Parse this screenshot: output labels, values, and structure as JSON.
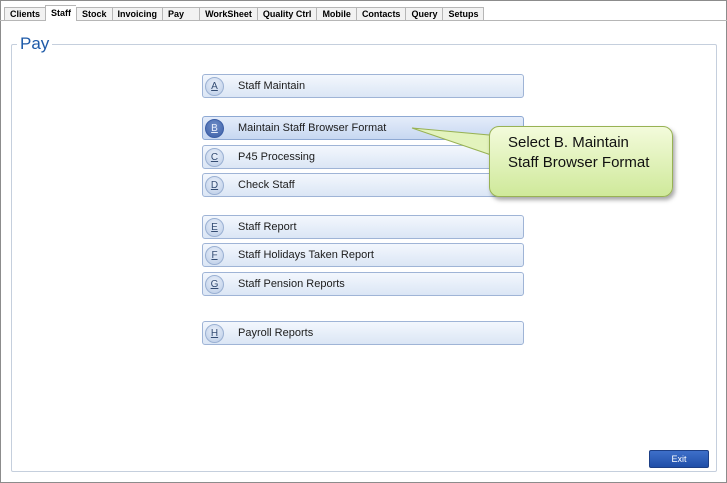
{
  "tabs": [
    {
      "label": "Clients"
    },
    {
      "label": "Staff",
      "active": true
    },
    {
      "label": "Stock"
    },
    {
      "label": "Invoicing"
    },
    {
      "label": "Pay"
    },
    {
      "label": "WorkSheet"
    },
    {
      "label": "Quality Ctrl"
    },
    {
      "label": "Mobile"
    },
    {
      "label": "Contacts"
    },
    {
      "label": "Query"
    },
    {
      "label": "Setups"
    }
  ],
  "page": {
    "title": "Pay"
  },
  "menu": [
    {
      "key": "A",
      "label": "Staff Maintain"
    },
    {
      "key": "B",
      "label": "Maintain Staff Browser Format",
      "highlighted": true
    },
    {
      "key": "C",
      "label": "P45 Processing"
    },
    {
      "key": "D",
      "label": "Check Staff"
    },
    {
      "key": "E",
      "label": "Staff Report"
    },
    {
      "key": "F",
      "label": "Staff Holidays Taken Report"
    },
    {
      "key": "G",
      "label": "Staff Pension Reports"
    },
    {
      "key": "H",
      "label": "Payroll Reports"
    }
  ],
  "callout": {
    "text": "Select B. Maintain Staff Browser Format"
  },
  "footer": {
    "exit_label": "Exit"
  },
  "colors": {
    "title_blue": "#1e5aa8",
    "button_border": "#9fb4d6",
    "callout_fill": "#cfe99a",
    "exit_button": "#1f4ea8"
  }
}
